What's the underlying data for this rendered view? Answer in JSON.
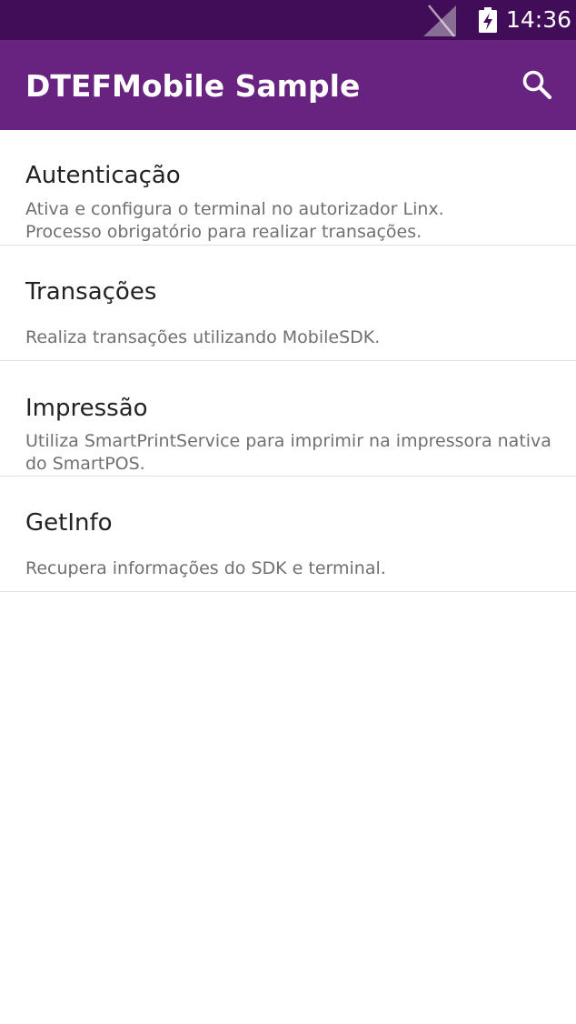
{
  "status_bar": {
    "time": "14:36",
    "signal_icon": "no-signal-icon",
    "battery_icon": "battery-charging-icon"
  },
  "app_bar": {
    "title": "DTEFMobile Sample",
    "search_icon": "search-icon",
    "background_color": "#68227f"
  },
  "menu": {
    "items": [
      {
        "title": "Autenticação",
        "description_lines": [
          "Ativa e configura o terminal no autorizador Linx.",
          "Processo obrigatório para realizar transações."
        ]
      },
      {
        "title": "Transações",
        "description_lines": [
          "Realiza transações utilizando MobileSDK."
        ]
      },
      {
        "title": "Impressão",
        "description_lines": [
          "Utiliza SmartPrintService para imprimir na impressora nativa",
          "do SmartPOS."
        ]
      },
      {
        "title": "GetInfo",
        "description_lines": [
          "Recupera informações do SDK e terminal."
        ]
      }
    ]
  }
}
